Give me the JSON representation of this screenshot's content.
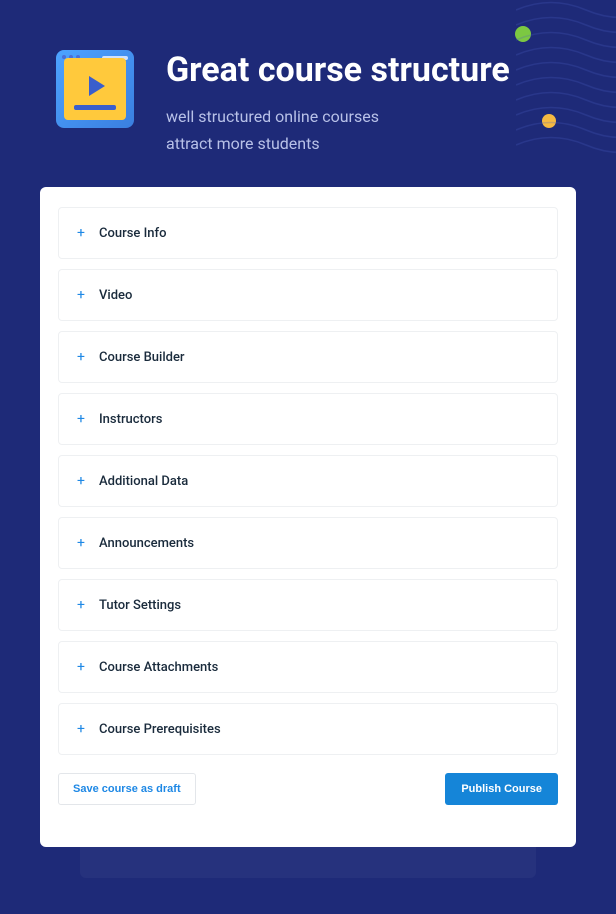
{
  "header": {
    "title": "Great course structure",
    "subtitle_line1": "well structured online courses",
    "subtitle_line2": "attract more students"
  },
  "accordion": [
    {
      "label": "Course Info"
    },
    {
      "label": "Video"
    },
    {
      "label": "Course Builder"
    },
    {
      "label": "Instructors"
    },
    {
      "label": "Additional Data"
    },
    {
      "label": "Announcements"
    },
    {
      "label": "Tutor Settings"
    },
    {
      "label": "Course Attachments"
    },
    {
      "label": "Course Prerequisites"
    }
  ],
  "footer": {
    "draft_label": "Save course as draft",
    "publish_label": "Publish Course"
  }
}
